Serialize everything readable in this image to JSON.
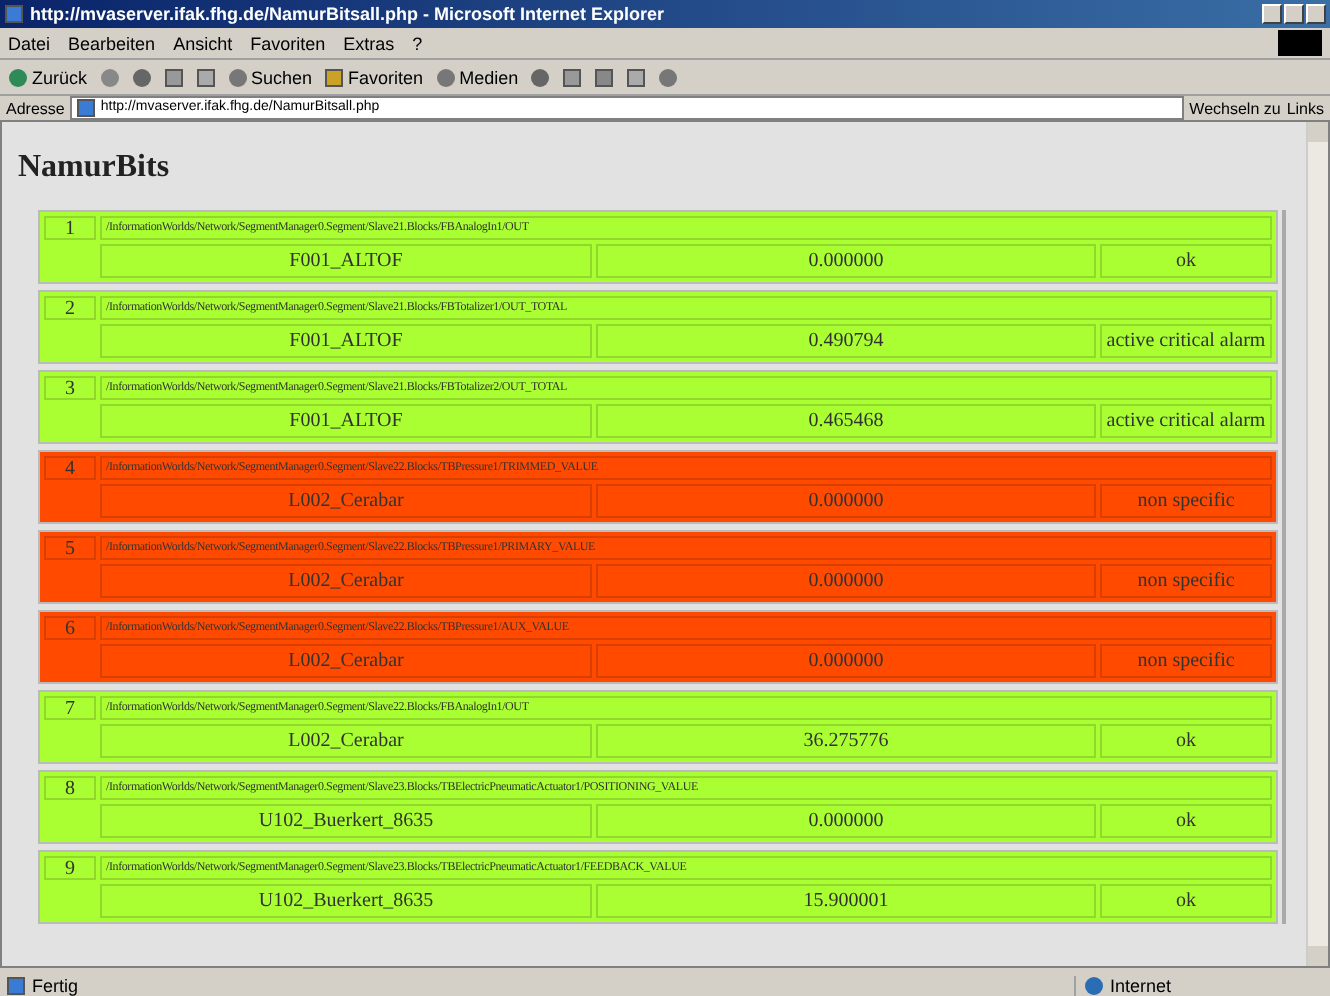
{
  "window": {
    "title": "http://mvaserver.ifak.fhg.de/NamurBitsall.php - Microsoft Internet Explorer"
  },
  "menu": [
    "Datei",
    "Bearbeiten",
    "Ansicht",
    "Favoriten",
    "Extras",
    "?"
  ],
  "toolbar": {
    "back": "Zurück",
    "search": "Suchen",
    "favorites": "Favoriten",
    "media": "Medien"
  },
  "address": {
    "label": "Adresse",
    "value": "http://mvaserver.ifak.fhg.de/NamurBitsall.php",
    "go": "Wechseln zu",
    "links": "Links"
  },
  "page": {
    "heading": "NamurBits",
    "rows": [
      {
        "index": "1",
        "path": "/InformationWorlds/Network/SegmentManager0.Segment/Slave21.Blocks/FBAnalogIn1/OUT",
        "device": "F001_ALTOF",
        "value": "0.000000",
        "status": "ok",
        "color": "#aaff33"
      },
      {
        "index": "2",
        "path": "/InformationWorlds/Network/SegmentManager0.Segment/Slave21.Blocks/FBTotalizer1/OUT_TOTAL",
        "device": "F001_ALTOF",
        "value": "0.490794",
        "status": "active critical alarm",
        "color": "#aaff33"
      },
      {
        "index": "3",
        "path": "/InformationWorlds/Network/SegmentManager0.Segment/Slave21.Blocks/FBTotalizer2/OUT_TOTAL",
        "device": "F001_ALTOF",
        "value": "0.465468",
        "status": "active critical alarm",
        "color": "#aaff33"
      },
      {
        "index": "4",
        "path": "/InformationWorlds/Network/SegmentManager0.Segment/Slave22.Blocks/TBPressure1/TRIMMED_VALUE",
        "device": "L002_Cerabar",
        "value": "0.000000",
        "status": "non specific",
        "color": "#ff4a00"
      },
      {
        "index": "5",
        "path": "/InformationWorlds/Network/SegmentManager0.Segment/Slave22.Blocks/TBPressure1/PRIMARY_VALUE",
        "device": "L002_Cerabar",
        "value": "0.000000",
        "status": "non specific",
        "color": "#ff4a00"
      },
      {
        "index": "6",
        "path": "/InformationWorlds/Network/SegmentManager0.Segment/Slave22.Blocks/TBPressure1/AUX_VALUE",
        "device": "L002_Cerabar",
        "value": "0.000000",
        "status": "non specific",
        "color": "#ff4a00"
      },
      {
        "index": "7",
        "path": "/InformationWorlds/Network/SegmentManager0.Segment/Slave22.Blocks/FBAnalogIn1/OUT",
        "device": "L002_Cerabar",
        "value": "36.275776",
        "status": "ok",
        "color": "#aaff33"
      },
      {
        "index": "8",
        "path": "/InformationWorlds/Network/SegmentManager0.Segment/Slave23.Blocks/TBElectricPneumaticActuator1/POSITIONING_VALUE",
        "device": "U102_Buerkert_8635",
        "value": "0.000000",
        "status": "ok",
        "color": "#aaff33"
      },
      {
        "index": "9",
        "path": "/InformationWorlds/Network/SegmentManager0.Segment/Slave23.Blocks/TBElectricPneumaticActuator1/FEEDBACK_VALUE",
        "device": "U102_Buerkert_8635",
        "value": "15.900001",
        "status": "ok",
        "color": "#aaff33"
      }
    ]
  },
  "status_bar": {
    "text": "Fertig",
    "zone": "Internet"
  }
}
